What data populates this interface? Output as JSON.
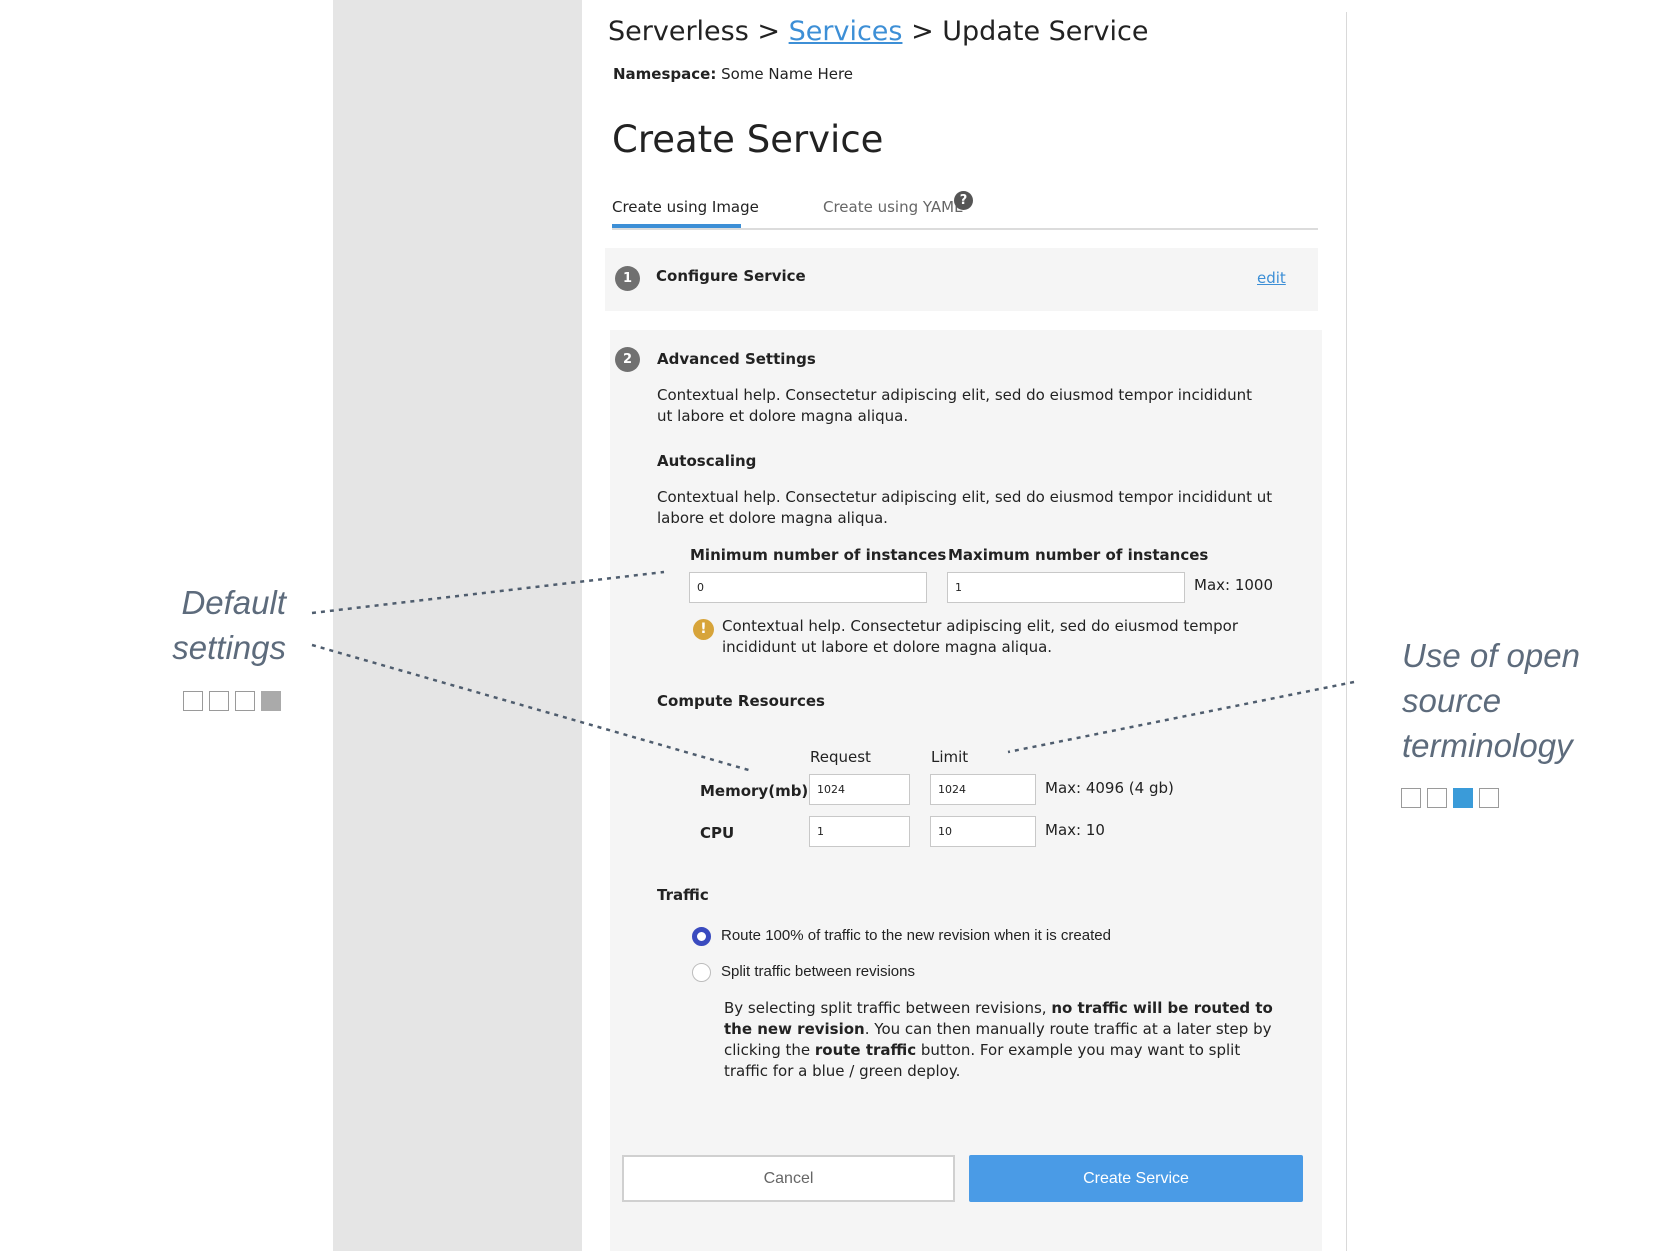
{
  "breadcrumb": {
    "root": "Serverless",
    "sep1": ">",
    "link": "Services",
    "sep2": ">",
    "current": "Update Service"
  },
  "namespace": {
    "label": "Namespace:",
    "value": "Some Name Here"
  },
  "page_title": "Create Service",
  "tabs": [
    {
      "label": "Create using Image",
      "active": true
    },
    {
      "label": "Create using YAML",
      "active": false
    }
  ],
  "help_glyph": "?",
  "step1": {
    "number": "1",
    "title": "Configure Service",
    "edit_label": "edit"
  },
  "step2": {
    "number": "2",
    "title": "Advanced Settings",
    "help": "Contextual help. Consectetur adipiscing elit, sed do eiusmod tempor incididunt ut labore et dolore magna aliqua.",
    "autoscaling": {
      "title": "Autoscaling",
      "help": "Contextual help. Consectetur adipiscing elit, sed do eiusmod tempor incididunt ut labore et dolore magna aliqua.",
      "min_label": "Minimum number of instances",
      "min_value": "0",
      "max_label": "Maximum number of instances",
      "max_value": "1",
      "max_note": "Max: 1000",
      "warn_glyph": "!",
      "warning": "Contextual help. Consectetur adipiscing elit, sed do eiusmod tempor incididunt ut labore et dolore magna aliqua."
    },
    "compute": {
      "title": "Compute Resources",
      "col_request": "Request",
      "col_limit": "Limit",
      "memory_label": "Memory(mb)",
      "memory_request": "1024",
      "memory_limit": "1024",
      "memory_note": "Max: 4096 (4 gb)",
      "cpu_label": "CPU",
      "cpu_request": "1",
      "cpu_limit": "10",
      "cpu_note": "Max: 10"
    },
    "traffic": {
      "title": "Traffic",
      "option1": "Route 100% of traffic to the new revision when it is created",
      "option2": "Split traffic between revisions",
      "selected": "option1",
      "desc_part1": "By selecting split traffic between revisions, ",
      "desc_bold1": "no traffic will be routed to the new revision",
      "desc_part2": ". You can then manually route traffic at a later step by clicking the ",
      "desc_bold2": "route traffic",
      "desc_part3": " button. For example you may want to split traffic for a blue / green deploy."
    }
  },
  "actions": {
    "cancel": "Cancel",
    "create": "Create Service"
  },
  "annotations": {
    "default_settings": {
      "line1": "Default",
      "line2": "settings",
      "squares_filled_index": 3,
      "filled_color": "#aaaaaa"
    },
    "open_source": {
      "line1": "Use of open",
      "line2": "source",
      "line3": "terminology",
      "squares_filled_index": 2,
      "filled_color": "#3a9bd9"
    }
  },
  "colors": {
    "accent": "#3d8fd6",
    "primary_button": "#4a9be6",
    "warning": "#d7a43a",
    "radio": "#3a4bbf",
    "annotation_text": "#5d6b7c"
  }
}
